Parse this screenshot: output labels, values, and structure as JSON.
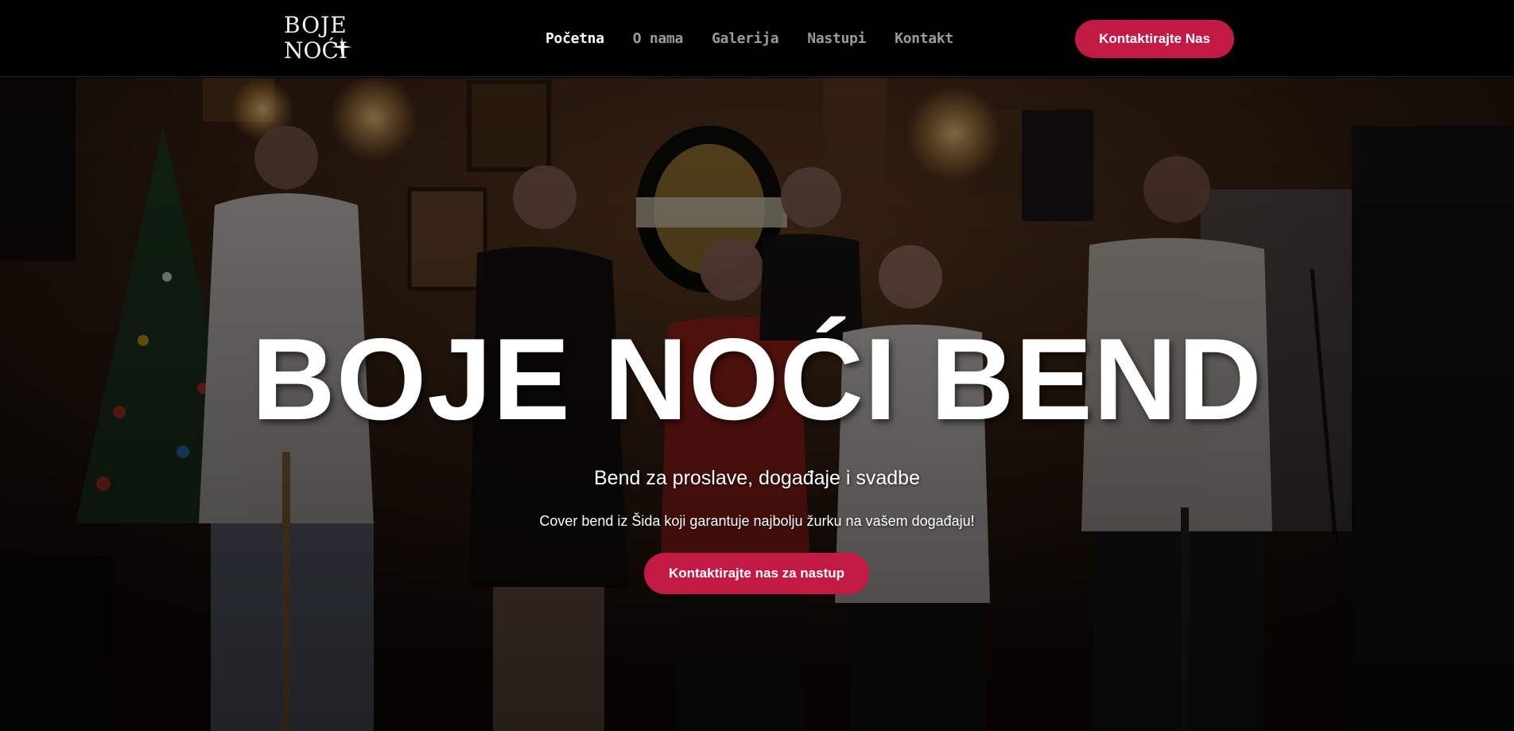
{
  "header": {
    "logo": {
      "line1": "BOJE",
      "line2": "NOĆI"
    },
    "nav": [
      {
        "label": "Početna",
        "active": true
      },
      {
        "label": "O nama",
        "active": false
      },
      {
        "label": "Galerija",
        "active": false
      },
      {
        "label": "Nastupi",
        "active": false
      },
      {
        "label": "Kontakt",
        "active": false
      }
    ],
    "cta_label": "Kontaktirajte Nas"
  },
  "hero": {
    "title": "BOJE NOĆI BEND",
    "subtitle": "Bend za proslave, događaje i svadbe",
    "description": "Cover bend iz Šida koji garantuje najbolju žurku na vašem događaju!",
    "cta_label": "Kontaktirajte nas za nastup",
    "background_image": "band-photo-in-pub"
  },
  "colors": {
    "accent": "#c21a45",
    "header_bg": "#000000",
    "nav_active": "#ffffff",
    "nav_inactive": "#9a9a9a"
  }
}
